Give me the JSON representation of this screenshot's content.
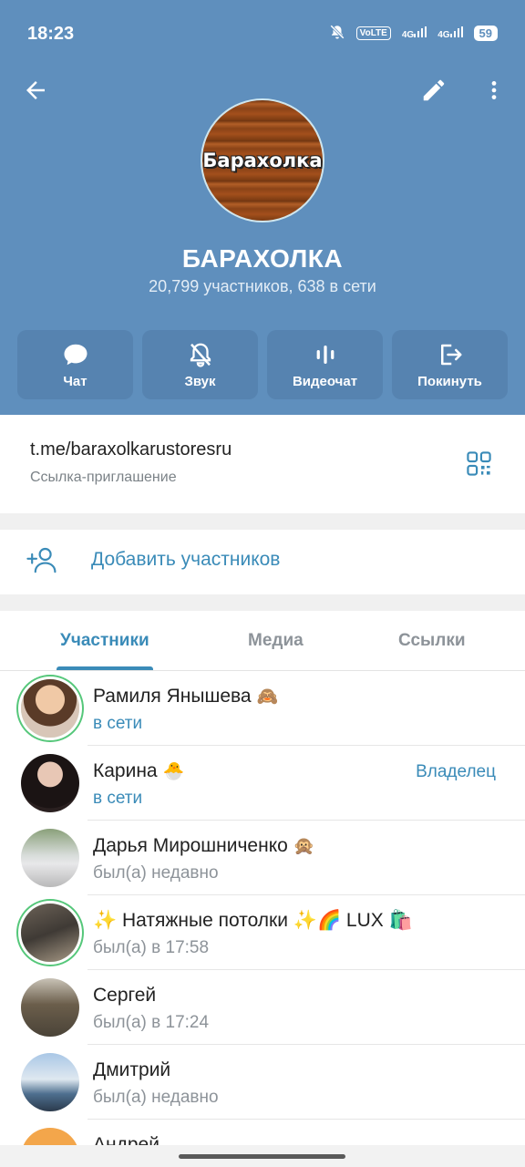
{
  "status_bar": {
    "time": "18:23",
    "volte": "VoLTE",
    "net1": "4G",
    "net2": "4G",
    "battery": "59",
    "icons": [
      "mute-bell-icon",
      "signal-icon",
      "signal-icon",
      "battery-icon"
    ]
  },
  "header": {
    "avatar_text": "Барахолка",
    "title": "БАРАХОЛКА",
    "subtitle": "20,799 участников, 638 в сети",
    "background_color": "#5f8fbd"
  },
  "actions": [
    {
      "label": "Чат",
      "icon": "chat-bubble-icon"
    },
    {
      "label": "Звук",
      "icon": "bell-off-icon"
    },
    {
      "label": "Видеочат",
      "icon": "voice-chat-icon"
    },
    {
      "label": "Покинуть",
      "icon": "leave-icon"
    }
  ],
  "invite": {
    "url": "t.me/baraxolkarustoresru",
    "caption": "Ссылка-приглашение"
  },
  "add_members": {
    "label": "Добавить участников"
  },
  "tabs": [
    {
      "label": "Участники",
      "active": true
    },
    {
      "label": "Медиа",
      "active": false
    },
    {
      "label": "Ссылки",
      "active": false
    }
  ],
  "members": [
    {
      "name": "Рамиля Янышева",
      "emoji": "🙈",
      "status": "в сети",
      "online": true,
      "role": ""
    },
    {
      "name": "Карина",
      "emoji": "🐣",
      "status": "в сети",
      "online": true,
      "role": "Владелец"
    },
    {
      "name": "Дарья Мирошниченко",
      "emoji": "🙊",
      "status": "был(а) недавно",
      "online": false,
      "role": ""
    },
    {
      "name": "✨ Натяжные потолки ✨🌈 LUX 🛍️",
      "emoji": "",
      "status": "был(а) в 17:58",
      "online": false,
      "role": ""
    },
    {
      "name": "Сергей",
      "emoji": "",
      "status": "был(а) в 17:24",
      "online": false,
      "role": ""
    },
    {
      "name": "Дмитрий",
      "emoji": "",
      "status": "был(а) недавно",
      "online": false,
      "role": ""
    },
    {
      "name": "Андрей",
      "emoji": "",
      "status": "",
      "online": false,
      "role": ""
    }
  ],
  "accent_color": "#3a8bb8"
}
